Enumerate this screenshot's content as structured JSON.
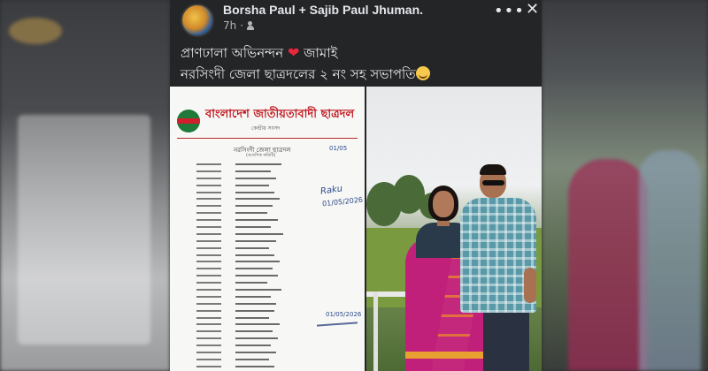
{
  "post": {
    "author": "Borsha Paul + Sajib Paul Jhuman.",
    "time": "7h",
    "audience_icon": "friends-icon",
    "more_icon": "more-horizontal-icon",
    "close_icon": "close-icon",
    "text_line1": "প্রাণঢালা অভিনন্দন",
    "text_line1_end": "জামাই",
    "text_line2": "নরসিংদী জেলা ছাত্রদলের ২ নং সহ সভাপতি",
    "heart_emoji": "❤"
  },
  "document": {
    "org_title": "বাংলাদেশ জাতীয়তাবাদী ছাত্রদল",
    "org_subtitle": "কেন্দ্রীয় সংসদ",
    "heading": "নরসিংদী জেলা ছাত্রদল",
    "sub_heading": "(আংশিক কমিটি)",
    "date_top": "01/05",
    "signature": "Raku",
    "signature_date": "01/05/2026",
    "stamp_date": "01/05/2026"
  },
  "colors": {
    "card_bg": "#242526",
    "text_primary": "#e4e6eb",
    "text_secondary": "#b0b3b8",
    "doc_title_red": "#c01820",
    "logo_green": "#1f7a3a"
  }
}
